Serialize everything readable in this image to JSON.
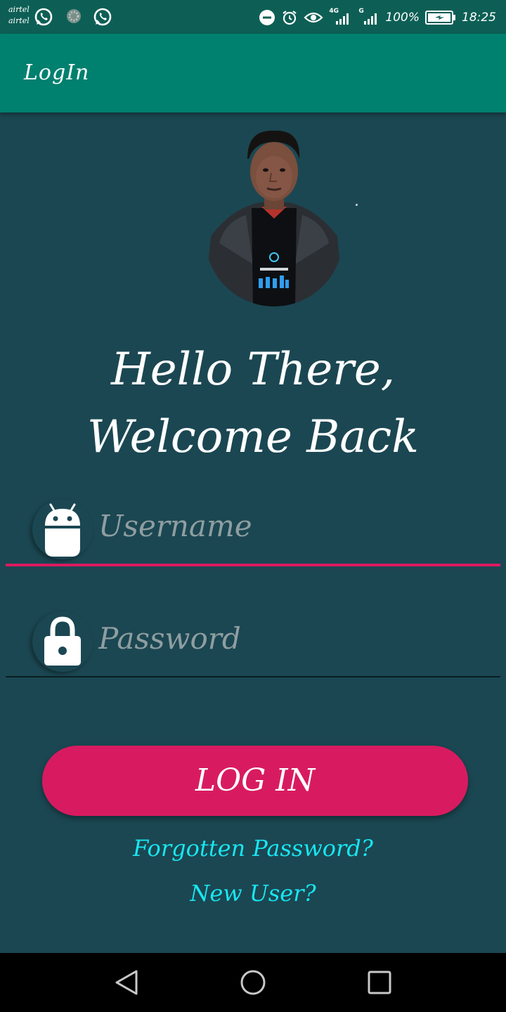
{
  "status_bar": {
    "carrier_1": "airtel",
    "carrier_2": "airtel",
    "network_1": "4G",
    "network_2": "G",
    "battery": "100%",
    "time": "18:25",
    "icons": [
      "whatsapp-icon",
      "spinner-icon",
      "whatsapp-icon",
      "do-not-disturb-icon",
      "alarm-icon",
      "eye-icon",
      "signal-icon",
      "signal-icon",
      "battery-charging-icon"
    ]
  },
  "app_bar": {
    "title": "LogIn"
  },
  "greeting": {
    "line1": "Hello There,",
    "line2": "Welcome Back"
  },
  "username": {
    "placeholder": "Username",
    "value": "",
    "icon": "android-icon"
  },
  "password": {
    "placeholder": "Password",
    "value": "",
    "icon": "lock-icon"
  },
  "login_button": {
    "label": "LOG IN"
  },
  "links": {
    "forgot": "Forgotten Password?",
    "new_user": "New User?"
  },
  "nav_bar": {
    "icons": [
      "back-icon",
      "home-icon",
      "recents-icon"
    ]
  },
  "colors": {
    "status_bar": "#0d5f55",
    "app_bar": "#00806f",
    "background": "#1b4752",
    "accent": "#d81b60",
    "link": "#18e6f0"
  }
}
